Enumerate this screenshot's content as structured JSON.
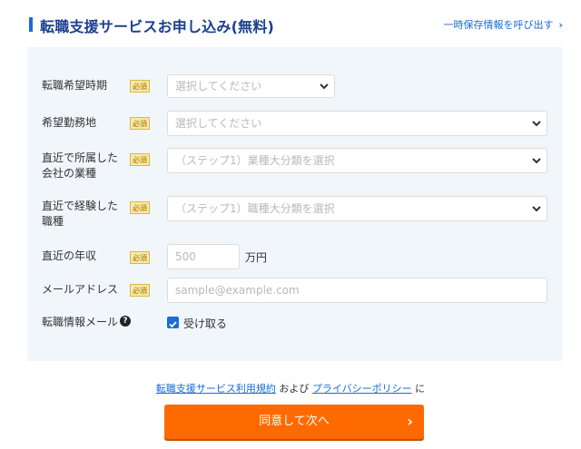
{
  "header": {
    "title": "転職支援サービスお申し込み(無料)",
    "recall_link": "一時保存情報を呼び出す"
  },
  "form": {
    "required_badge": "必須",
    "fields": [
      {
        "label": "転職希望時期",
        "placeholder": "選択してください",
        "type": "select"
      },
      {
        "label": "希望勤務地",
        "placeholder": "選択してください",
        "type": "select"
      },
      {
        "label": "直近で所属した\n会社の業種",
        "placeholder": "（ステップ1）業種大分類を選択",
        "type": "select"
      },
      {
        "label": "直近で経験した\n職種",
        "placeholder": "（ステップ1）職種大分類を選択",
        "type": "select"
      },
      {
        "label": "直近の年収",
        "placeholder": "500",
        "unit": "万円",
        "type": "text"
      },
      {
        "label": "メールアドレス",
        "placeholder": "sample@example.com",
        "type": "text"
      }
    ],
    "newsletter": {
      "label": "転職情報メール",
      "help_icon": "?",
      "checkbox_label": "受け取る",
      "checked": true
    }
  },
  "terms": {
    "link1": "転職支援サービス利用規約",
    "and": "および",
    "link2": "プライバシーポリシー",
    "suffix": "に"
  },
  "submit": {
    "label": "同意して次へ",
    "arrow": "›"
  },
  "colors": {
    "accent": "#1a6dd4",
    "title": "#1b3f8f",
    "panel": "#f1f6fb",
    "button": "#ff6a00",
    "badge_bg": "#f7e9a6"
  }
}
